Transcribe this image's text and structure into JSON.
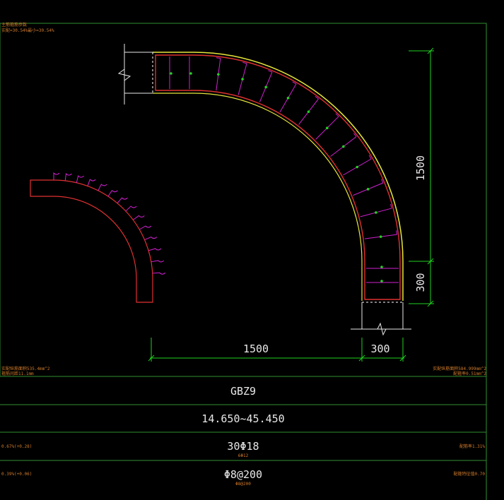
{
  "drawing": {
    "top_notes": [
      "主筋箍筋参数",
      "实配=30.54%最小=30.54%"
    ],
    "dimensions": {
      "right_vertical_long": "1500",
      "right_vertical_short": "300",
      "bottom_long": "1500",
      "bottom_short": "300"
    },
    "side_notes": {
      "left_area": "实配纵筋面积535.4mm^2",
      "left_area2": "箍筋间距11.1mm",
      "right_area": "实配纵筋面积584.999mm^2",
      "right_area2": "配箍率0.51mm^2"
    }
  },
  "table": {
    "rows": [
      {
        "main": "GBZ9",
        "sub": "",
        "left": "",
        "right": ""
      },
      {
        "main": "14.650~45.450",
        "sub": "",
        "left": "",
        "right": ""
      },
      {
        "main": "30Φ18",
        "sub": "6Φ12",
        "left": "0.67%(+0.28)",
        "right": "配筋率1.31%"
      },
      {
        "main": "Φ8@200",
        "sub": "Φ8@200",
        "left": "0.39%(+0.06)",
        "right": "配箍特征值0.70"
      }
    ]
  },
  "colors": {
    "frame": "#2f8f2f",
    "dimension": "#1fd21f",
    "outline": "#e03030",
    "stirrup": "#d020d0",
    "edge": "#e6e63a",
    "text": "#e8e8e8",
    "note": "#d07a2a"
  }
}
